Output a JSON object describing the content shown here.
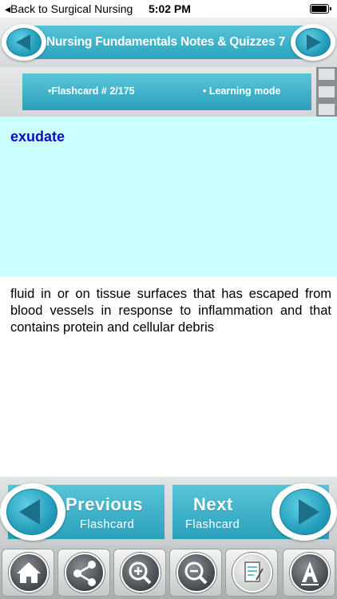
{
  "status_bar": {
    "back_label": "Back to  Surgical Nursing",
    "time": "5:02 PM",
    "battery_level": 0.95
  },
  "header": {
    "title": "Nursing Fundamentals Notes & Quizzes 7"
  },
  "flashcard_info": {
    "counter": "•Flashcard #  2/175",
    "mode": "• Learning mode"
  },
  "card": {
    "term": "exudate",
    "definition": "fluid in or on tissue surfaces that has escaped from blood vessels in response to inflammation and that contains protein and cellular debris"
  },
  "navigation": {
    "previous_big": "Previous",
    "previous_small": "Flashcard",
    "next_big": "Next",
    "next_small": "Flashcard"
  },
  "toolbar": {
    "icons": [
      "home-icon",
      "share-icon",
      "zoom-in-icon",
      "zoom-out-icon",
      "notes-icon",
      "font-icon"
    ]
  },
  "colors": {
    "accent": "#2ca4bf",
    "term_background": "#ccffff",
    "term_text": "#0a0ac8"
  }
}
